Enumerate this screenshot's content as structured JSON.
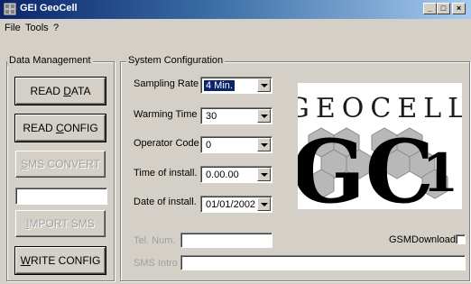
{
  "window": {
    "title": "GEI GeoCell",
    "minimize_glyph": "_",
    "maximize_glyph": "□",
    "close_glyph": "×"
  },
  "menu": {
    "items": [
      "File",
      "Tools",
      "?"
    ]
  },
  "data_management": {
    "label": "Data Management",
    "buttons": {
      "read_data": "READ DATA",
      "read_config": "READ CONFIG",
      "sms_convert": "SMS CONVERT",
      "import_sms": "IMPORT SMS",
      "write_config": "WRITE CONFIG"
    },
    "sms_text_value": ""
  },
  "system_configuration": {
    "label": "System Configuration",
    "sampling_rate": {
      "label": "Sampling Rate",
      "value": "4 Min."
    },
    "warming_time": {
      "label": "Warming Time",
      "value": "30"
    },
    "operator_code": {
      "label": "Operator Code",
      "value": "0"
    },
    "time_of_install": {
      "label": "Time of install.",
      "value": "0.00.00"
    },
    "date_of_install": {
      "label": "Date of install.",
      "value": "01/01/2002"
    },
    "tel_num": {
      "label": "Tel. Num.",
      "value": ""
    },
    "sms_intro": {
      "label": "SMS Intro",
      "value": ""
    },
    "gsm_download": {
      "label": "GSMDownload",
      "checked": false
    }
  },
  "logo": {
    "wordmark": "GEOCELL",
    "monogram": "GC",
    "number": "1"
  }
}
